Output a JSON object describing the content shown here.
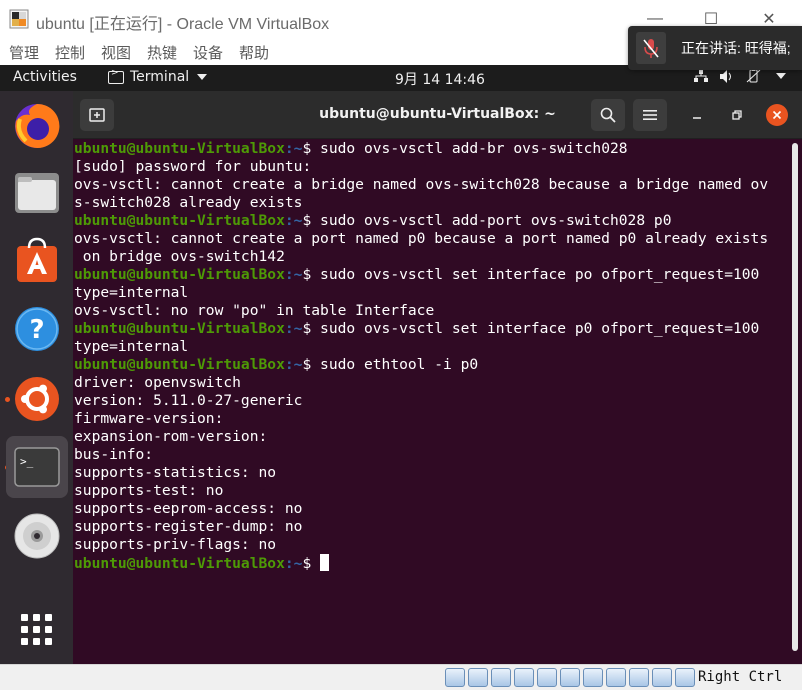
{
  "host_window": {
    "title": "ubuntu [正在运行] - Oracle VM VirtualBox",
    "minimize_glyph": "—",
    "maximize_glyph": "☐",
    "close_glyph": "✕",
    "menu": [
      "管理",
      "控制",
      "视图",
      "热键",
      "设备",
      "帮助"
    ]
  },
  "notification": {
    "icon": "microphone-muted-icon",
    "text": "正在讲话: 旺得福;"
  },
  "gnome_topbar": {
    "activities": "Activities",
    "app_menu": "Terminal",
    "clock": "9月 14  14:46",
    "tray_icons": [
      "network-icon",
      "volume-icon",
      "power-icon",
      "dropdown-icon"
    ]
  },
  "dock": {
    "items": [
      {
        "name": "firefox",
        "running": false,
        "active": false
      },
      {
        "name": "files",
        "running": false,
        "active": false
      },
      {
        "name": "software-center",
        "running": false,
        "active": false
      },
      {
        "name": "help",
        "running": false,
        "active": false
      },
      {
        "name": "ubuntu-installer",
        "running": true,
        "active": false
      },
      {
        "name": "terminal",
        "running": true,
        "active": true
      },
      {
        "name": "dvd-drive",
        "running": false,
        "active": false
      },
      {
        "name": "show-applications",
        "running": false,
        "active": false
      }
    ]
  },
  "terminal": {
    "title": "ubuntu@ubuntu-VirtualBox: ~",
    "prompt_user": "ubuntu@ubuntu-VirtualBox",
    "prompt_path": ":~",
    "prompt_sign": "$ ",
    "lines": [
      {
        "prompt": true,
        "text": "sudo ovs-vsctl add-br ovs-switch028"
      },
      {
        "prompt": false,
        "text": "[sudo] password for ubuntu:"
      },
      {
        "prompt": false,
        "text": "ovs-vsctl: cannot create a bridge named ovs-switch028 because a bridge named ov"
      },
      {
        "prompt": false,
        "text": "s-switch028 already exists"
      },
      {
        "prompt": true,
        "text": "sudo ovs-vsctl add-port ovs-switch028 p0"
      },
      {
        "prompt": false,
        "text": "ovs-vsctl: cannot create a port named p0 because a port named p0 already exists"
      },
      {
        "prompt": false,
        "text": " on bridge ovs-switch142"
      },
      {
        "prompt": true,
        "text": "sudo ovs-vsctl set interface po ofport_request=100"
      },
      {
        "prompt": false,
        "text": "type=internal"
      },
      {
        "prompt": false,
        "text": "ovs-vsctl: no row \"po\" in table Interface"
      },
      {
        "prompt": true,
        "text": "sudo ovs-vsctl set interface p0 ofport_request=100"
      },
      {
        "prompt": false,
        "text": "type=internal"
      },
      {
        "prompt": true,
        "text": "sudo ethtool -i p0"
      },
      {
        "prompt": false,
        "text": "driver: openvswitch"
      },
      {
        "prompt": false,
        "text": "version: 5.11.0-27-generic"
      },
      {
        "prompt": false,
        "text": "firmware-version:"
      },
      {
        "prompt": false,
        "text": "expansion-rom-version:"
      },
      {
        "prompt": false,
        "text": "bus-info:"
      },
      {
        "prompt": false,
        "text": "supports-statistics: no"
      },
      {
        "prompt": false,
        "text": "supports-test: no"
      },
      {
        "prompt": false,
        "text": "supports-eeprom-access: no"
      },
      {
        "prompt": false,
        "text": "supports-register-dump: no"
      },
      {
        "prompt": false,
        "text": "supports-priv-flags: no"
      },
      {
        "prompt": true,
        "text": "",
        "cursor": true
      }
    ]
  },
  "status_bar": {
    "icons": [
      "hard-disk-icon",
      "optical-drive-icon",
      "audio-icon",
      "network-icon",
      "usb-icon",
      "shared-folders-icon",
      "display-icon",
      "video-capture-icon",
      "vm-state-icon",
      "mouse-integration-icon",
      "keyboard-capture-icon"
    ],
    "host_key": "Right Ctrl"
  },
  "colors": {
    "terminal_bg": "#300a24",
    "prompt_user": "#4e9a06",
    "prompt_path": "#3465a4",
    "ubuntu_orange": "#e95420",
    "dock_bg": "#2f2a30"
  }
}
